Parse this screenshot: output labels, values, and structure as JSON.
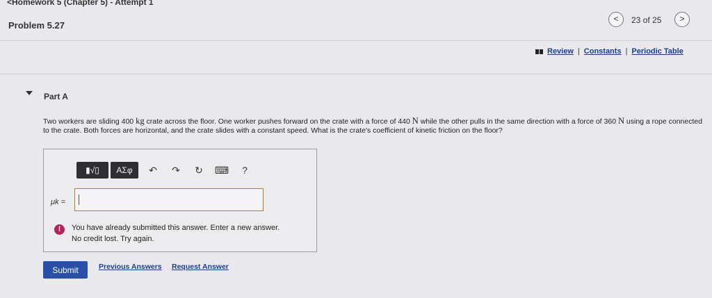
{
  "header": {
    "breadcrumb": "<Homework 5 (Chapter 5) - Attempt 1",
    "problem_title": "Problem 5.27",
    "pagination": {
      "prev_symbol": "<",
      "next_symbol": ">",
      "count_text": "23 of 25"
    }
  },
  "resources": {
    "review": "Review",
    "constants": "Constants",
    "periodic_table": "Periodic Table",
    "separator": "|"
  },
  "part": {
    "label": "Part A"
  },
  "question": {
    "segments": [
      "Two workers are sliding 400 ",
      "kg",
      " crate across the floor. One worker pushes forward on the crate with a force of 440 ",
      "N",
      " while the other pulls in the same direction with a force of 360 ",
      "N",
      " using a rope connected to the crate. Both forces are horizontal, and the crate slides with a constant speed. What is the crate's coefficient of kinetic friction on the floor?"
    ]
  },
  "toolbar": {
    "template_button": "▮√▯",
    "symbols_button": "ΑΣφ",
    "undo_symbol": "↶",
    "redo_symbol": "↷",
    "reset_symbol": "↻",
    "keyboard_symbol": "⌨",
    "help_symbol": "?"
  },
  "answer": {
    "label": "μk =",
    "value": ""
  },
  "feedback": {
    "icon": "!",
    "line1": "You have already submitted this answer. Enter a new answer.",
    "line2": "No credit lost. Try again."
  },
  "actions": {
    "submit": "Submit",
    "previous_answers": "Previous Answers",
    "request_answer": "Request Answer"
  }
}
